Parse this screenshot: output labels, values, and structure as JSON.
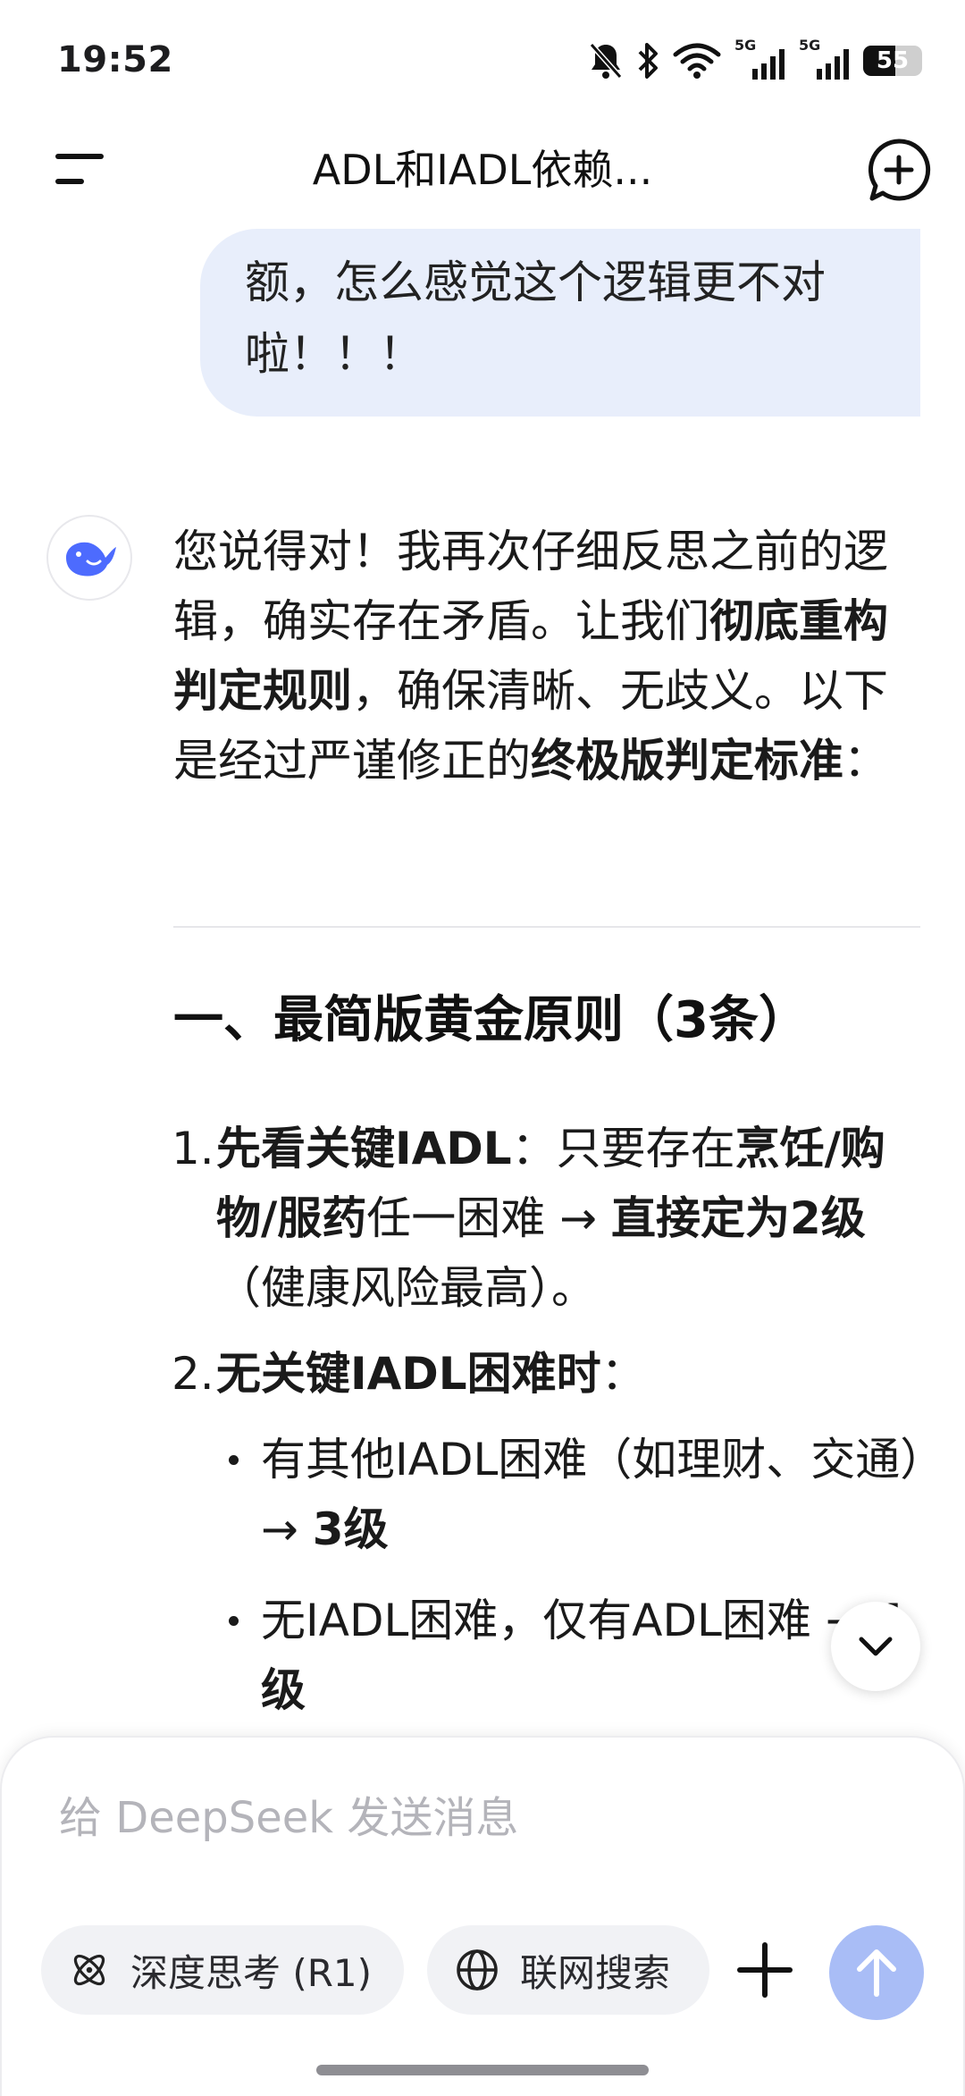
{
  "status_bar": {
    "time": "19:52",
    "network_1": "5G",
    "network_2": "5G",
    "battery_percent": 55,
    "battery_label": "55",
    "icons": [
      "mute-bell-icon",
      "bluetooth-icon",
      "wifi-icon",
      "signal-icon",
      "signal-icon",
      "battery-icon"
    ]
  },
  "header": {
    "title": "ADL和IADL依赖...",
    "menu_icon": "menu-icon",
    "new_chat_icon": "new-chat-icon"
  },
  "user_message": {
    "text": "额，怎么感觉这个逻辑更不对啦！！！"
  },
  "assistant": {
    "avatar_icon": "deepseek-whale-icon",
    "intro": {
      "p1": "您说得对！我再次仔细反思之前的逻辑，确实存在矛盾。让我们",
      "b1": "彻底重构判定规则",
      "p2": "，确保清晰、无歧义。以下是经过严谨修正的",
      "b2": "终极版判定标准",
      "p3": "："
    },
    "section_title": "一、最简版黄金原则（3条）",
    "items": [
      {
        "num": "1.",
        "b1": "先看关键IADL",
        "t1": "：只要存在",
        "b2": "烹饪/购物/服药",
        "t2": "任一困难 → ",
        "b3": "直接定为2级",
        "t3": "（健康风险最高）。"
      },
      {
        "num": "2.",
        "b1": "无关键IADL困难时",
        "t1": "：",
        "subitems": [
          {
            "t": "有其他IADL困难（如理财、交通）→ ",
            "b": "3级"
          },
          {
            "t": "无IADL困难，仅有ADL困难 → ",
            "b": "1级"
          }
        ]
      }
    ]
  },
  "composer": {
    "placeholder": "给 DeepSeek 发送消息",
    "deep_think_label": "深度思考 (R1)",
    "web_search_label": "联网搜索",
    "plus_icon": "plus-icon",
    "send_icon": "send-arrow-icon"
  },
  "colors": {
    "user_bubble": "#e8eefb",
    "send_button": "#a9bdf6",
    "brand_blue": "#4d6bfe"
  }
}
